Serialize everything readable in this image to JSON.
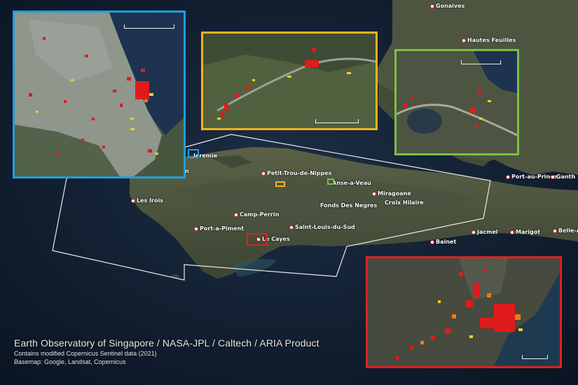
{
  "credits": {
    "title": "Earth Observatory of Singapore / NASA-JPL / Caltech / ARIA Product",
    "line1": "Contains modified Copernicus Sentinel data (2021)",
    "line2": "Basemap: Google, Landsat, Copernicus"
  },
  "places": [
    {
      "id": "gonaives",
      "label": "Gonaives"
    },
    {
      "id": "hautes-feuilles",
      "label": "Hautes Feuilles"
    },
    {
      "id": "jeremie",
      "label": "Jeremie"
    },
    {
      "id": "petit-trou",
      "label": "Petit-Trou-de-Nippes"
    },
    {
      "id": "anse-a-veau",
      "label": "Anse-a-Veau"
    },
    {
      "id": "miragoane",
      "label": "Miragoane"
    },
    {
      "id": "croix-hilaire",
      "label": "Croix Hilaire"
    },
    {
      "id": "fonds-des-negres",
      "label": "Fonds Des Negres"
    },
    {
      "id": "les-irois",
      "label": "Les Irois"
    },
    {
      "id": "camp-perrin",
      "label": "Camp-Perrin"
    },
    {
      "id": "port-a-piment",
      "label": "Port-a-Piment"
    },
    {
      "id": "saint-louis-du-sud",
      "label": "Saint-Louis-du-Sud"
    },
    {
      "id": "les-cayes",
      "label": "Le  Cayes"
    },
    {
      "id": "bainet",
      "label": "Bainet"
    },
    {
      "id": "jacmel",
      "label": "Jacmel"
    },
    {
      "id": "marigot",
      "label": "Marigot"
    },
    {
      "id": "belle-a",
      "label": "Belle-A"
    },
    {
      "id": "port-au-prince",
      "label": "Port-au-Prince"
    },
    {
      "id": "ganthier",
      "label": "Ganth"
    },
    {
      "id": "n-fragment",
      "label": "n"
    }
  ],
  "insets": [
    {
      "id": "jeremie",
      "color": "#1e9fe0"
    },
    {
      "id": "petit-trou",
      "color": "#f2b21c"
    },
    {
      "id": "anse-a-veau",
      "color": "#7bc043"
    },
    {
      "id": "les-cayes",
      "color": "#e02020"
    }
  ],
  "colors": {
    "damage_high": "#e01b1b",
    "damage_mid": "#f07a12",
    "damage_low": "#f5d020",
    "footprint": "#e8e8e8"
  }
}
